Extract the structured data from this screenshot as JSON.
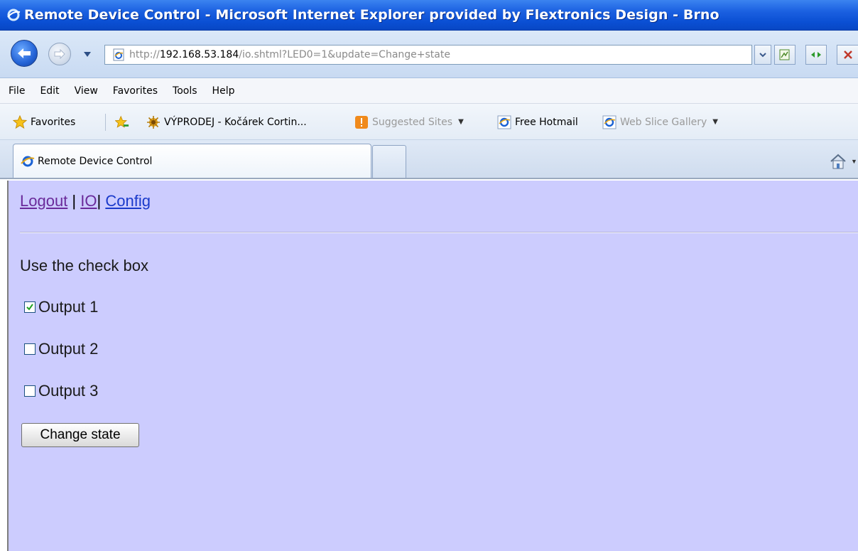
{
  "window": {
    "title": "Remote Device Control - Microsoft Internet Explorer provided by Flextronics Design - Brno"
  },
  "address_bar": {
    "url_prefix": "http://",
    "url_host": "192.168.53.184",
    "url_path": "/io.shtml?LED0=1&update=Change+state"
  },
  "menu": [
    "File",
    "Edit",
    "View",
    "Favorites",
    "Tools",
    "Help"
  ],
  "favorites_bar": {
    "favorites_label": "Favorites",
    "item1": "VÝPRODEJ - Kočárek Cortin...",
    "item2": "Suggested Sites",
    "item3": "Free Hotmail",
    "item4": "Web Slice Gallery"
  },
  "tabs": {
    "active_tab": "Remote Device Control"
  },
  "page": {
    "links": {
      "logout": "Logout",
      "sep1": "|",
      "io": "IO",
      "sep2": "|",
      "config": "Config"
    },
    "instruction": "Use the check box",
    "outputs": [
      {
        "label": "Output 1",
        "checked": true
      },
      {
        "label": "Output 2",
        "checked": false
      },
      {
        "label": "Output 3",
        "checked": false
      }
    ],
    "submit_label": "Change state"
  },
  "colors": {
    "page_background": "#ccccfe",
    "titlebar": "#0a4fd3",
    "link": "#1a3acb",
    "visited_link": "#6a2a9a"
  }
}
